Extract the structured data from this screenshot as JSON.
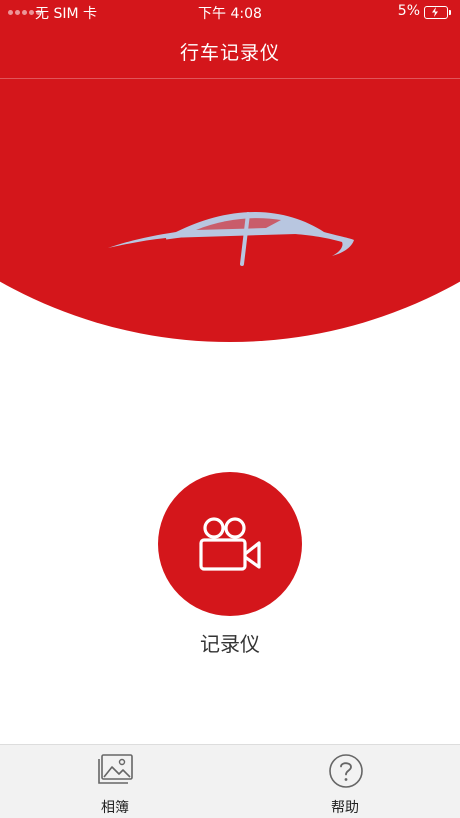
{
  "status_bar": {
    "carrier": "无 SIM 卡",
    "time": "下午 4:08",
    "battery": "5%"
  },
  "nav": {
    "title": "行车记录仪"
  },
  "main": {
    "record_label": "记录仪"
  },
  "tab_bar": {
    "items": [
      {
        "label": "相簿",
        "icon": "photo-album-icon"
      },
      {
        "label": "帮助",
        "icon": "help-icon"
      }
    ]
  },
  "colors": {
    "primary_red": "#d4161b",
    "car_logo": "#b8c6e0",
    "tab_bar_bg": "#f2f2f2"
  }
}
